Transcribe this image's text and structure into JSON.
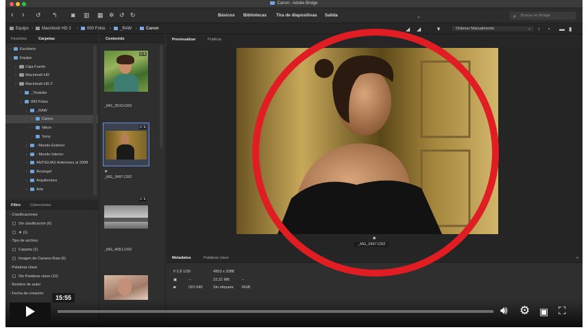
{
  "window": {
    "title": "Canon - Adobe Bridge"
  },
  "toolbar": {
    "workspaces": [
      "Básicos",
      "Bibliotecas",
      "Tira de diapositivas",
      "Salida"
    ],
    "search_placeholder": "Buscar en Bridge"
  },
  "path": {
    "crumbs": [
      "Equipo",
      "Macintosh HD 2",
      "000 Fotos",
      "_RAW",
      "Canon"
    ],
    "sort_label": "Ordenar Manualmente"
  },
  "left_panel": {
    "tabs": [
      "Favoritos",
      "Carpetas"
    ],
    "tree": [
      {
        "label": "Escritorio"
      },
      {
        "label": "Equipo"
      },
      {
        "label": "Caja Fuerte"
      },
      {
        "label": "Macintosh HD"
      },
      {
        "label": "Macintosh HD 2"
      },
      {
        "label": "_Youtube"
      },
      {
        "label": "000 Fotos"
      },
      {
        "label": "_RAW"
      },
      {
        "label": "Canon"
      },
      {
        "label": "Nikon"
      },
      {
        "label": "Sony"
      },
      {
        "label": "- Mundo Exterior"
      },
      {
        "label": "- Mundo Interior"
      },
      {
        "label": "ANTIGUAS Anteriores al 2008"
      },
      {
        "label": "Arcangel"
      },
      {
        "label": "Arquitectura"
      },
      {
        "label": "Arte"
      }
    ]
  },
  "filter_panel": {
    "tabs": [
      "Filtro",
      "Colecciones"
    ],
    "items": [
      {
        "label": "Clasificaciones",
        "kind": "header"
      },
      {
        "label": "Sin clasificación (6)",
        "kind": "check"
      },
      {
        "label": "★ (1)",
        "kind": "check"
      },
      {
        "label": "Tipo de archivo",
        "kind": "header"
      },
      {
        "label": "Carpeta (1)",
        "kind": "check"
      },
      {
        "label": "Imagen de Camera Raw (6)",
        "kind": "check"
      },
      {
        "label": "Palabras clave",
        "kind": "header"
      },
      {
        "label": "Sin Palabras clave (10)",
        "kind": "check"
      },
      {
        "label": "Nombre de autor",
        "kind": "header"
      },
      {
        "label": "Fecha de creación",
        "kind": "header"
      }
    ]
  },
  "content_panel": {
    "tab": "Contenido",
    "thumbs": [
      {
        "name": "_MG_3510.CR2",
        "star": ""
      },
      {
        "name": "_MG_3497.CR2",
        "star": "★"
      },
      {
        "name": "_MG_4051.CR2",
        "star": ""
      }
    ]
  },
  "preview_panel": {
    "tabs": [
      "Previsualizar",
      "Publicar"
    ],
    "filename": "_MG_3497.CR2",
    "star": "★"
  },
  "metadata_panel": {
    "tabs": [
      "Metadatos",
      "Palabras clave"
    ],
    "exposure": "f/ 2,8  1/30",
    "dimensions": "4953 x 3388",
    "size": "22,21 MB",
    "iso": "ISO 640",
    "label": "Sin etiqueta",
    "color": "RGB",
    "dash1": "--",
    "dash2": "--"
  },
  "video": {
    "timestamp": "15:55"
  },
  "colors": {
    "accent_ring": "#e01d22",
    "folder": "#6fa3dc",
    "selection": "#454545"
  }
}
